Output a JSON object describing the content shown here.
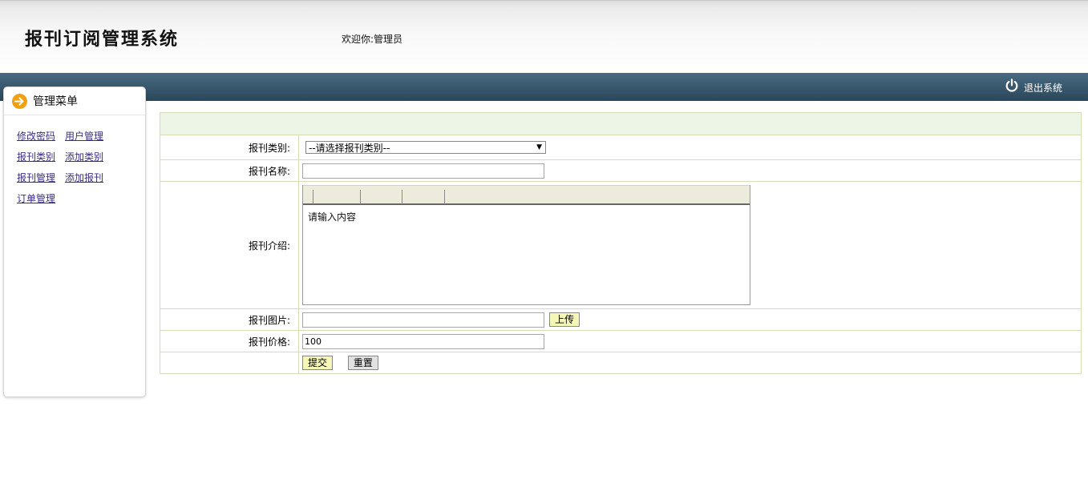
{
  "header": {
    "app_title": "报刊订阅管理系统",
    "welcome": "欢迎你:管理员"
  },
  "topbar": {
    "logout_label": "退出系统",
    "logout_icon": "power-icon"
  },
  "sidebar": {
    "title": "管理菜单",
    "title_icon": "arrow-right-icon",
    "links": [
      [
        "修改密码",
        "用户管理"
      ],
      [
        "报刊类别",
        "添加类别"
      ],
      [
        "报刊管理",
        "添加报刊"
      ],
      [
        "订单管理"
      ]
    ]
  },
  "form": {
    "category": {
      "label": "报刊类别:",
      "value": "--请选择报刊类别--"
    },
    "name": {
      "label": "报刊名称:",
      "value": ""
    },
    "intro": {
      "label": "报刊介绍:",
      "content": "请输入内容"
    },
    "image": {
      "label": "报刊图片:",
      "value": "",
      "upload_label": "上传"
    },
    "price": {
      "label": "报刊价格:",
      "value": "100"
    },
    "submit_label": "提交",
    "reset_label": "重置"
  },
  "colors": {
    "topbar": "#3a5a70",
    "header_row": "#edf5e6",
    "cell_border": "#d6dcb8",
    "link": "#3b2d86",
    "button_yellow": "#f6f7b6",
    "icon_orange": "#f0a010"
  }
}
